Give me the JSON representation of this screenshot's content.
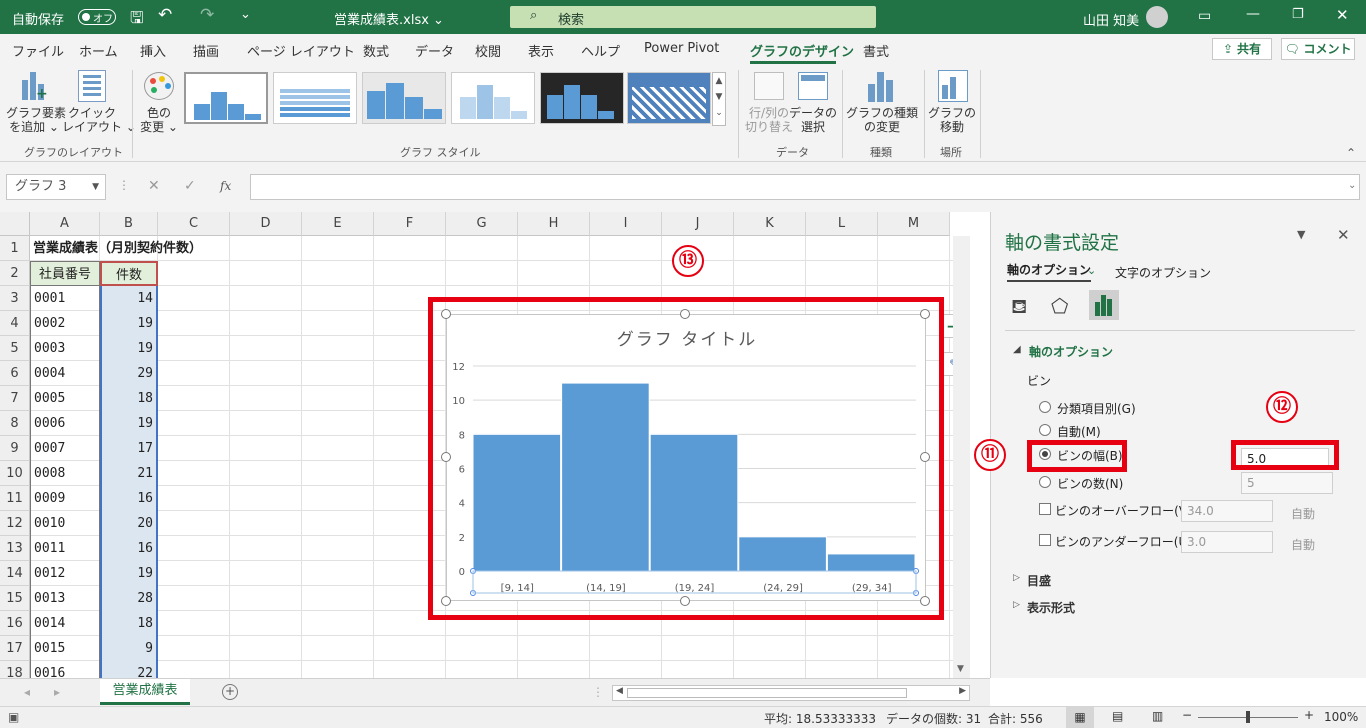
{
  "titlebar": {
    "autosave_label": "自動保存",
    "autosave_state": "オフ",
    "filename": "営業成績表.xlsx",
    "search_placeholder": "検索",
    "user_name": "山田 知美"
  },
  "ribbon_tabs": [
    "ファイル",
    "ホーム",
    "挿入",
    "描画",
    "ページ レイアウト",
    "数式",
    "データ",
    "校閲",
    "表示",
    "ヘルプ",
    "Power Pivot",
    "グラフのデザイン",
    "書式"
  ],
  "share_label": "共有",
  "comment_label": "コメント",
  "ribbon": {
    "add_element": "グラフ要素\nを追加 ⌄",
    "quick_layout": "クイック\nレイアウト ⌄",
    "change_colors": "色の\n変更 ⌄",
    "switch_row_col": "行/列の\n切り替え",
    "select_data": "データの\n選択",
    "change_type": "グラフの種類\nの変更",
    "move_chart": "グラフの\n移動",
    "group_layout": "グラフのレイアウト",
    "group_styles": "グラフ スタイル",
    "group_data": "データ",
    "group_type": "種類",
    "group_location": "場所"
  },
  "formula_bar": {
    "name_box": "グラフ 3",
    "fx": "fx",
    "formula": ""
  },
  "sheet": {
    "columns": [
      "A",
      "B",
      "C",
      "D",
      "E",
      "F",
      "G",
      "H",
      "I",
      "J",
      "K",
      "L",
      "M"
    ],
    "rows": [
      "1",
      "2",
      "3",
      "4",
      "5",
      "6",
      "7",
      "8",
      "9",
      "10",
      "11",
      "12",
      "13",
      "14",
      "15",
      "16",
      "17",
      "18"
    ],
    "title": "営業成績表（月別契約件数）",
    "header_a": "社員番号",
    "header_b": "件数",
    "data": [
      [
        "0001",
        "14"
      ],
      [
        "0002",
        "19"
      ],
      [
        "0003",
        "19"
      ],
      [
        "0004",
        "29"
      ],
      [
        "0005",
        "18"
      ],
      [
        "0006",
        "19"
      ],
      [
        "0007",
        "17"
      ],
      [
        "0008",
        "21"
      ],
      [
        "0009",
        "16"
      ],
      [
        "0010",
        "20"
      ],
      [
        "0011",
        "16"
      ],
      [
        "0012",
        "19"
      ],
      [
        "0013",
        "28"
      ],
      [
        "0014",
        "18"
      ],
      [
        "0015",
        "9"
      ],
      [
        "0016",
        "22"
      ]
    ],
    "sheet_tab": "営業成績表"
  },
  "chart_data": {
    "type": "bar",
    "title": "グラフ タイトル",
    "categories": [
      "[9, 14]",
      "(14, 19]",
      "(19, 24]",
      "(24, 29]",
      "(29, 34]"
    ],
    "values": [
      8,
      11,
      8,
      2,
      1
    ],
    "ylim": [
      0,
      12
    ],
    "yticks": [
      "0",
      "2",
      "4",
      "6",
      "8",
      "10",
      "12"
    ],
    "color": "#5b9bd5"
  },
  "pane": {
    "title": "軸の書式設定",
    "tab_axis": "軸のオプション",
    "tab_text": "文字のオプション",
    "section_axis": "軸のオプション",
    "bin_label": "ビン",
    "opt_category": "分類項目別(G)",
    "opt_auto": "自動(M)",
    "opt_bin_width": "ビンの幅(B)",
    "opt_bin_count": "ビンの数(N)",
    "bin_width_value": "5.0",
    "bin_count_value": "5",
    "overflow_label": "ビンのオーバーフロー(V)",
    "overflow_value": "34.0",
    "underflow_label": "ビンのアンダーフロー(U)",
    "underflow_value": "3.0",
    "auto_label": "自動",
    "section_ticks": "目盛",
    "section_format": "表示形式"
  },
  "badges": {
    "b11": "⑪",
    "b12": "⑫",
    "b13": "⑬"
  },
  "statusbar": {
    "average": "平均: 18.53333333",
    "count": "データの個数: 31",
    "sum": "合計: 556",
    "zoom": "100%"
  },
  "colors": {
    "excel_green": "#217346",
    "highlight_red": "#e60012"
  }
}
